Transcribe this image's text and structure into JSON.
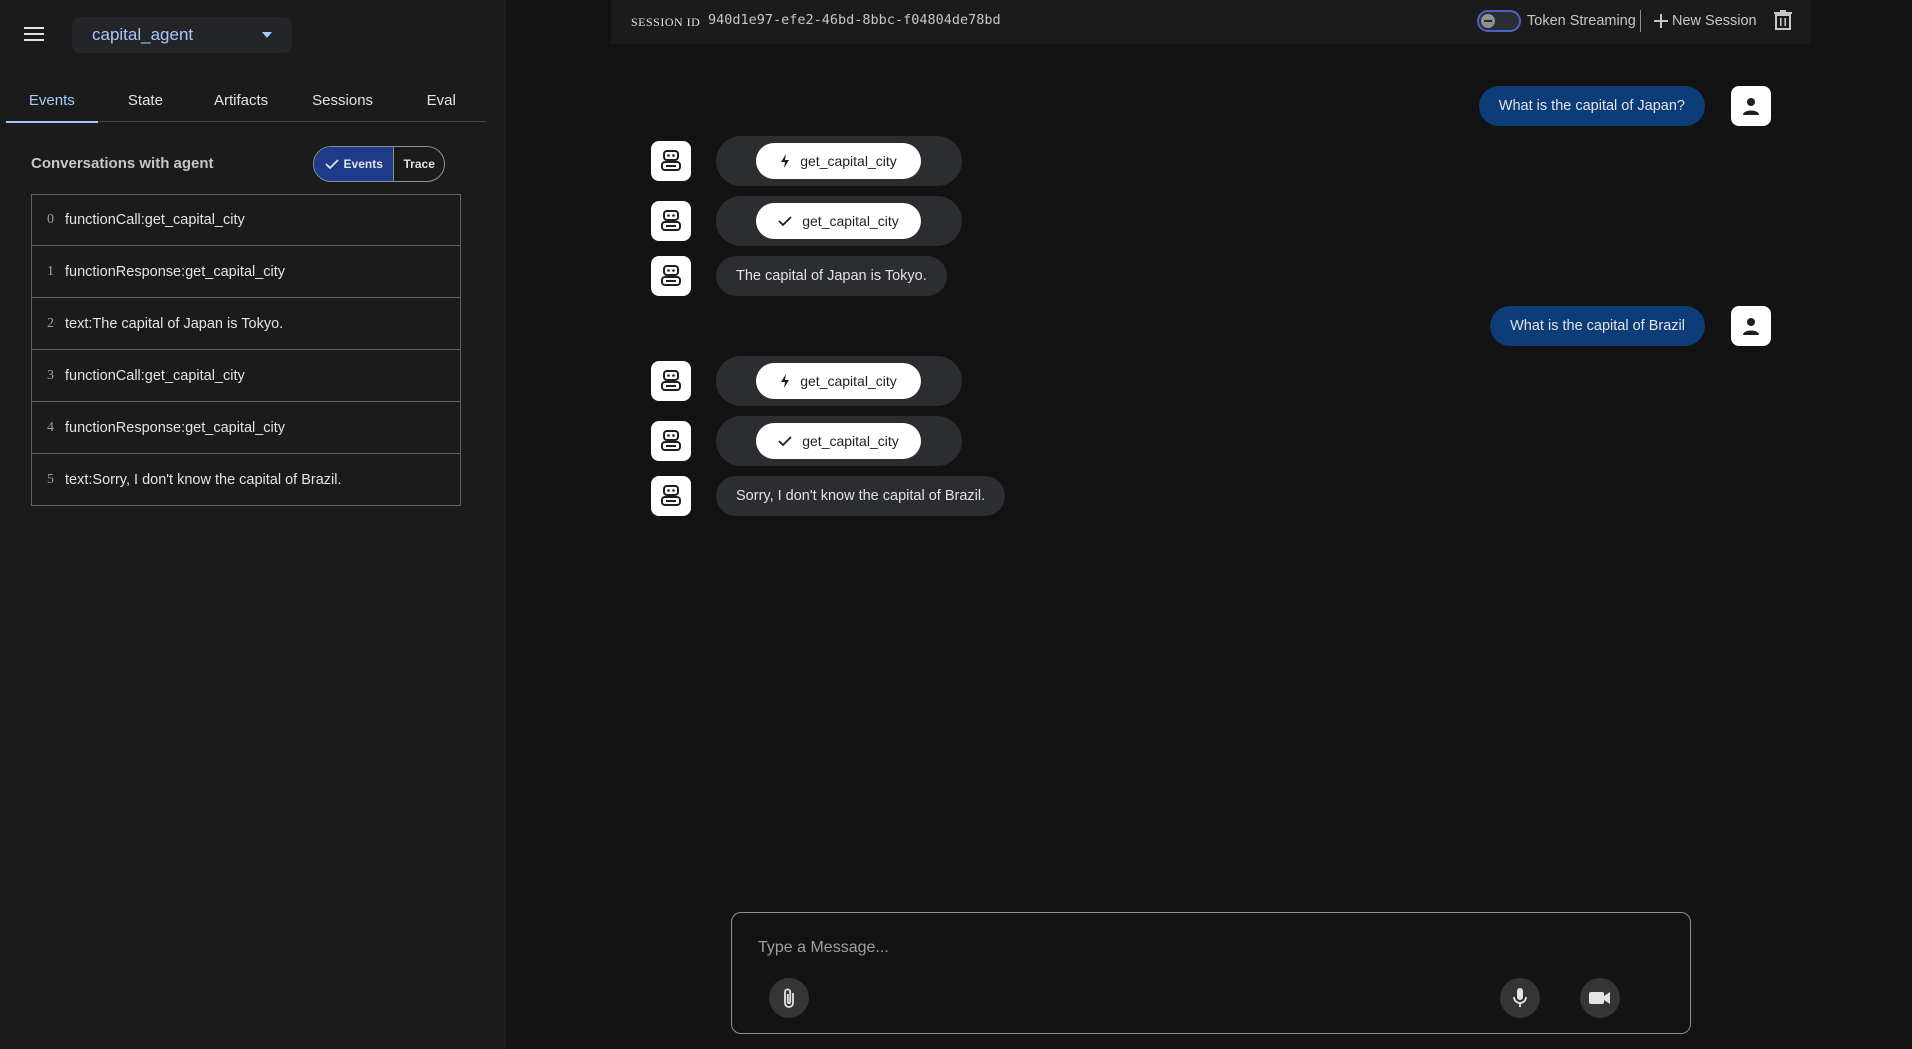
{
  "sidebar": {
    "agent_name": "capital_agent",
    "tabs": [
      {
        "label": "Events"
      },
      {
        "label": "State"
      },
      {
        "label": "Artifacts"
      },
      {
        "label": "Sessions"
      },
      {
        "label": "Eval"
      }
    ],
    "conversations_title": "Conversations with agent",
    "view_toggle": {
      "events_label": "Events",
      "trace_label": "Trace"
    },
    "events": [
      {
        "index": "0",
        "text": "functionCall:get_capital_city"
      },
      {
        "index": "1",
        "text": "functionResponse:get_capital_city"
      },
      {
        "index": "2",
        "text": "text:The capital of Japan is Tokyo."
      },
      {
        "index": "3",
        "text": "functionCall:get_capital_city"
      },
      {
        "index": "4",
        "text": "functionResponse:get_capital_city"
      },
      {
        "index": "5",
        "text": "text:Sorry, I don't know the capital of Brazil."
      }
    ]
  },
  "header": {
    "session_label": "SESSION ID",
    "session_id": "940d1e97-efe2-46bd-8bbc-f04804de78bd",
    "token_streaming_label": "Token Streaming",
    "new_session_label": "New Session"
  },
  "chat": {
    "user_1": "What is the capital of Japan?",
    "call_1": "get_capital_city",
    "response_1": "get_capital_city",
    "answer_1": "The capital of Japan is Tokyo.",
    "user_2": "What is the capital of Brazil",
    "call_2": "get_capital_city",
    "response_2": "get_capital_city",
    "answer_2": "Sorry, I don't know the capital of Brazil."
  },
  "input": {
    "placeholder": "Type a Message..."
  },
  "icons": {
    "menu": "menu-icon",
    "bot": "bot-icon",
    "user": "person-icon",
    "call": "bolt-icon",
    "response": "check-icon",
    "attach": "paperclip-icon",
    "mic": "mic-icon",
    "video": "videocam-icon",
    "trash": "trash-icon",
    "add": "plus-icon"
  },
  "colors": {
    "accent": "#a8c7fa",
    "user_bubble": "#0d3d78",
    "toggle_active": "#1f3a8a"
  }
}
